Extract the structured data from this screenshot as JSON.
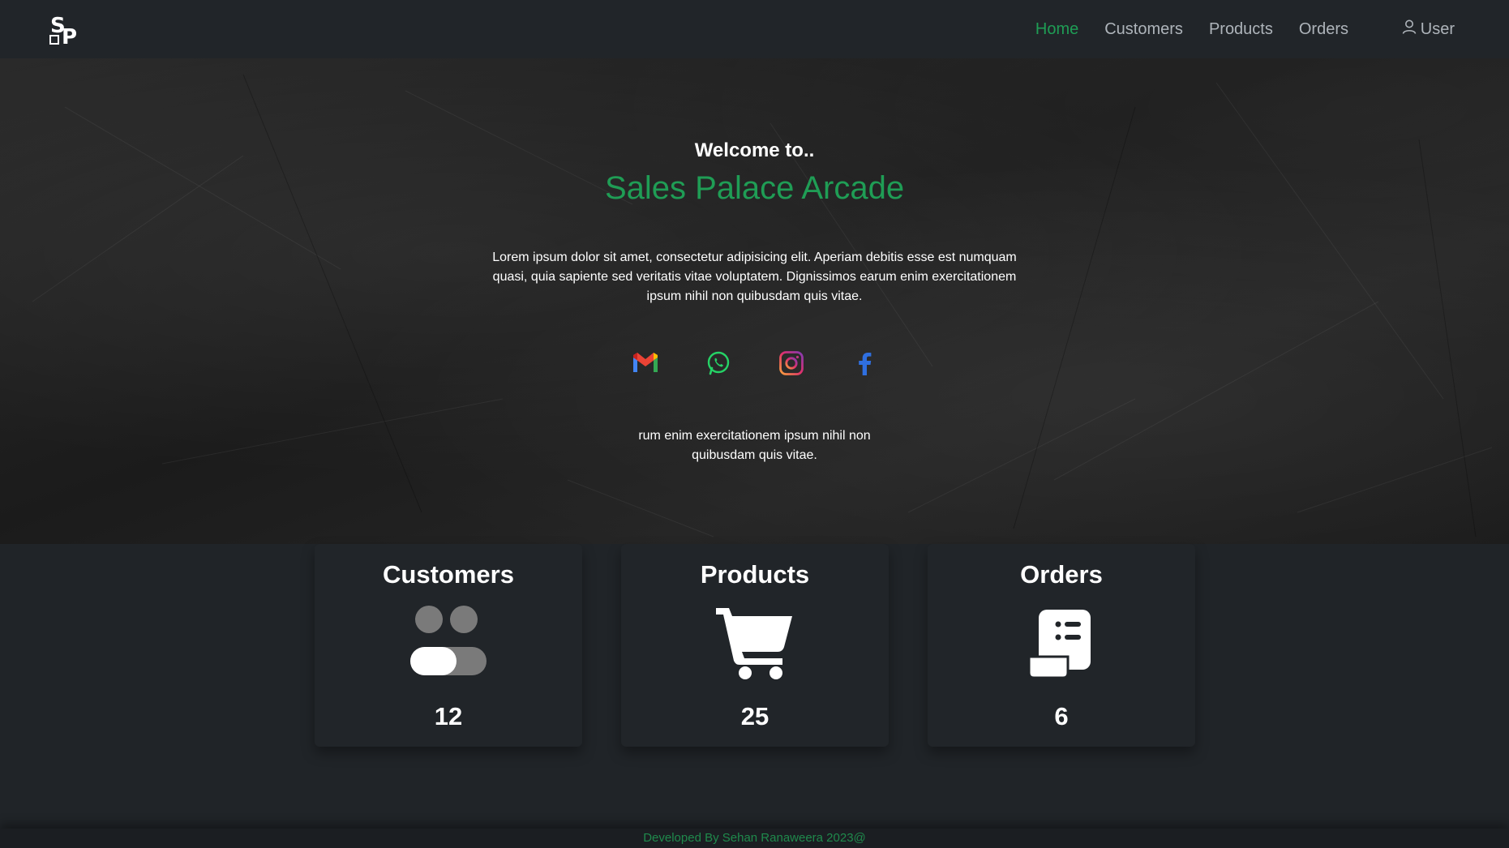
{
  "nav": {
    "logo_text": "SP",
    "links": [
      {
        "label": "Home",
        "active": true
      },
      {
        "label": "Customers",
        "active": false
      },
      {
        "label": "Products",
        "active": false
      },
      {
        "label": "Orders",
        "active": false
      }
    ],
    "user_label": "User"
  },
  "hero": {
    "welcome": "Welcome to..",
    "brand": "Sales Palace Arcade",
    "intro": "Lorem ipsum dolor sit amet, consectetur adipisicing elit. Aperiam debitis esse est numquam quasi, quia sapiente sed veritatis vitae voluptatem. Dignissimos earum enim exercitationem ipsum nihil non quibusdam quis vitae.",
    "socials": [
      "gmail-icon",
      "whatsapp-icon",
      "instagram-icon",
      "facebook-icon"
    ],
    "outro": "rum enim exercitationem ipsum nihil non quibusdam quis vitae."
  },
  "cards": [
    {
      "title": "Customers",
      "icon": "toggle-users-icon",
      "count": "12"
    },
    {
      "title": "Products",
      "icon": "cart-icon",
      "count": "25"
    },
    {
      "title": "Orders",
      "icon": "receipt-list-icon",
      "count": "6"
    }
  ],
  "footer": {
    "text": "Developed By Sehan Ranaweera 2023@"
  },
  "colors": {
    "accent": "#1f9d55",
    "navbar": "#212529",
    "background": "#202428"
  }
}
